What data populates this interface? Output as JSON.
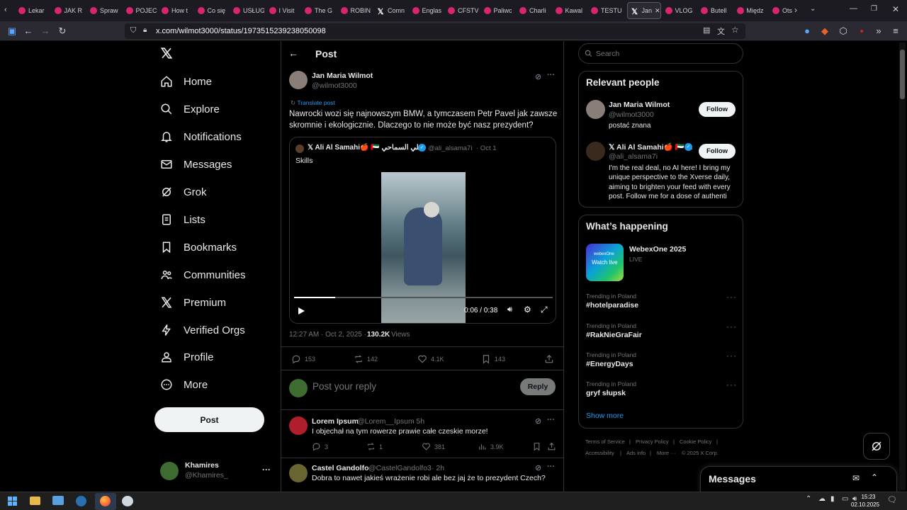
{
  "browser": {
    "tabs": [
      {
        "label": "Lekar"
      },
      {
        "label": "JAK R"
      },
      {
        "label": "Spraw"
      },
      {
        "label": "POJEC"
      },
      {
        "label": "How t"
      },
      {
        "label": "Co się"
      },
      {
        "label": "USŁUG"
      },
      {
        "label": "I Visit"
      },
      {
        "label": "The G"
      },
      {
        "label": "ROBIN"
      },
      {
        "label": "Comn"
      },
      {
        "label": "Englas"
      },
      {
        "label": "CFSTV"
      },
      {
        "label": "Paliwc"
      },
      {
        "label": "Charli"
      },
      {
        "label": "Kawal"
      },
      {
        "label": "TESTU"
      },
      {
        "label": "Jan"
      },
      {
        "label": "VLOG"
      },
      {
        "label": "Butell"
      },
      {
        "label": "Międz"
      },
      {
        "label": "Ots"
      }
    ],
    "url": "x.com/wilmot3000/status/1973515239238050098"
  },
  "nav": {
    "home": "Home",
    "explore": "Explore",
    "notifications": "Notifications",
    "messages": "Messages",
    "grok": "Grok",
    "lists": "Lists",
    "bookmarks": "Bookmarks",
    "communities": "Communities",
    "premium": "Premium",
    "verified_orgs": "Verified Orgs",
    "profile": "Profile",
    "more": "More",
    "post_button": "Post"
  },
  "account": {
    "name": "Khamires",
    "handle": "@Khamires_"
  },
  "header": {
    "title": "Post"
  },
  "post": {
    "author_name": "Jan Maria Wilmot",
    "author_handle": "@wilmot3000",
    "translate": "Translate post",
    "text": "Nawrocki wozi się najnowszym BMW, a tymczasem Petr Pavel jak zawsze skromnie i ekologicznie. Dlaczego to nie może być nasz prezydent?",
    "quote": {
      "name": "𝕏 Ali Al Samahi🍎 🇦🇪 علي السماحي",
      "handle": "@ali_alsama7i",
      "date": "· Oct 1",
      "text": "Skills",
      "video_time": "0:06 / 0:38",
      "progress": 0.16
    },
    "timestamp": "12:27 AM · Oct 2, 2025 ·",
    "views_count": "130.2K",
    "views_label": "Views",
    "replies": "153",
    "reposts": "142",
    "likes": "4.1K",
    "bookmarks": "143"
  },
  "reply_box": {
    "placeholder": "Post your reply",
    "button": "Reply"
  },
  "replies": [
    {
      "name": "Lorem Ipsum",
      "handle": "@Lorem__Ipsum",
      "time": "· 5h",
      "text": "I objechał na tym rowerze prawie całe czeskie morze!",
      "replies": "3",
      "reposts": "1",
      "likes": "381",
      "views": "3.9K"
    },
    {
      "name": "Castel Gandolfo",
      "handle": "@CastelGandolfo3",
      "time": "· 2h",
      "text": "Dobra to nawet jakieś wrażenie robi ale bez jaj że to prezydent Czech?"
    }
  ],
  "search": {
    "placeholder": "Search"
  },
  "relevant": {
    "title": "Relevant people",
    "people": [
      {
        "name": "Jan Maria Wilmot",
        "handle": "@wilmot3000",
        "bio": "postać znana",
        "button": "Follow"
      },
      {
        "name": "𝕏 Ali Al Samahi🍎 🇦🇪 ...",
        "handle": "@ali_alsama7i",
        "bio": "I'm the real deal, no AI here! I bring my unique perspective to the Xverse daily, aiming to brighten your feed with every post. Follow me for a dose of authenti",
        "button": "Follow"
      }
    ]
  },
  "happening": {
    "title": "What’s happening",
    "event": {
      "name": "WebexOne 2025",
      "status": "LIVE",
      "thumb_text": "Watch live",
      "thumb_brand": "webexOne"
    },
    "trends": [
      {
        "meta": "Trending in Poland",
        "name": "#hotelparadise"
      },
      {
        "meta": "Trending in Poland",
        "name": "#RakNieGraFair"
      },
      {
        "meta": "Trending in Poland",
        "name": "#EnergyDays"
      },
      {
        "meta": "Trending in Poland",
        "name": "gryf słupsk"
      }
    ],
    "show_more": "Show more"
  },
  "footer": {
    "links": [
      "Terms of Service",
      "|",
      "Privacy Policy",
      "|",
      "Cookie Policy",
      "|",
      "Accessibility",
      "|",
      "Ads info",
      "|",
      "More ···",
      "© 2025 X Corp."
    ]
  },
  "messages_drawer": {
    "title": "Messages"
  },
  "taskbar": {
    "time": "15:23",
    "date": "02.10.2025"
  },
  "colors": {
    "accent": "#1d9bf0",
    "bg": "#000000",
    "border": "#2f3336",
    "muted": "#71767b"
  }
}
